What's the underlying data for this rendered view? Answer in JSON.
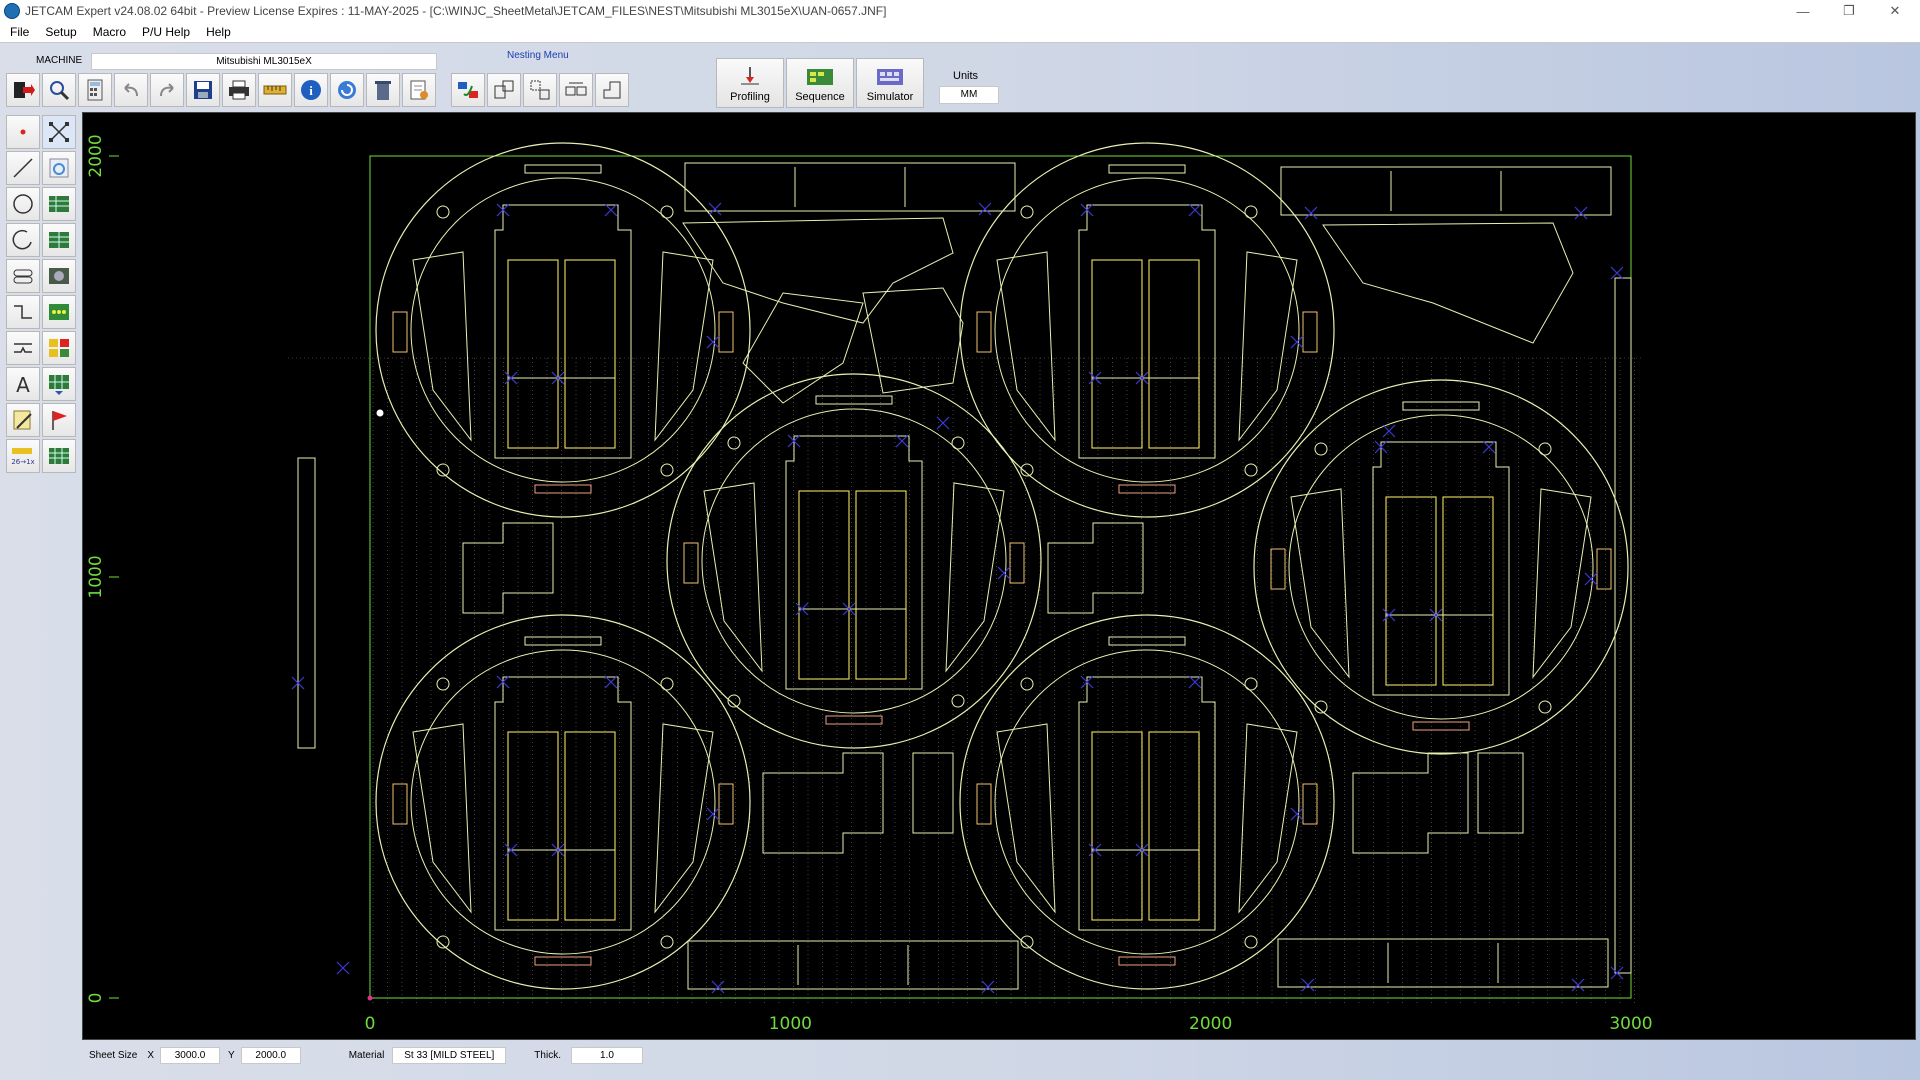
{
  "window": {
    "title": "JETCAM  Expert v24.08.02 64bit - Preview  License Expires : 11-MAY-2025  - [C:\\WINJC_SheetMetal\\JETCAM_FILES\\NEST\\Mitsubishi ML3015eX\\UAN-0657.JNF]",
    "minimize": "—",
    "restore": "❐",
    "close": "✕"
  },
  "menu": [
    "File",
    "Setup",
    "Macro",
    "P/U Help",
    "Help"
  ],
  "machine": {
    "label": "MACHINE",
    "value": "Mitsubishi ML3015eX"
  },
  "nesting_menu_label": "Nesting Menu",
  "big_buttons": [
    {
      "name": "profiling",
      "label": "Profiling",
      "icon": "profiling-icon"
    },
    {
      "name": "sequence",
      "label": "Sequence",
      "icon": "sequence-icon"
    },
    {
      "name": "simulator",
      "label": "Simulator",
      "icon": "simulator-icon"
    }
  ],
  "units": {
    "label": "Units",
    "value": "MM"
  },
  "toolbar_icons": [
    "exit-icon",
    "zoom-icon",
    "calculator-icon",
    "undo-icon",
    "redo-icon",
    "save-icon",
    "print-icon",
    "measure-icon",
    "info-icon",
    "refresh-icon",
    "delete-icon",
    "properties-icon"
  ],
  "nesting_icons": [
    "auto-nest-icon",
    "nest-part-icon",
    "move-part-icon",
    "array-part-icon",
    "remnant-icon"
  ],
  "left_tools": [
    "point-icon",
    "snap-icon",
    "line-icon",
    "part-info-icon",
    "circle-icon",
    "grid-icon",
    "arc-icon",
    "table-icon",
    "slot-icon",
    "camera-icon",
    "step-icon",
    "array-icon",
    "bridge-icon",
    "color-grid-icon",
    "text-icon",
    "part-list-icon",
    "edit-icon",
    "flag-icon",
    "dimension-icon",
    "sheet-grid-icon"
  ],
  "dimension_text": "26→1x",
  "axis": {
    "x_ticks": [
      "0",
      "1000",
      "2000",
      "3000"
    ],
    "y_ticks": [
      "0",
      "1000",
      "2000"
    ]
  },
  "colors": {
    "background": "#000000",
    "geometry": "#e8f0b0",
    "axis": "#6fdc3c",
    "markers": "#3b3bd6",
    "gridlines": "#bfbfbf"
  },
  "status": {
    "sheet_size_label": "Sheet Size",
    "x_label": "X",
    "x_value": "3000.0",
    "y_label": "Y",
    "y_value": "2000.0",
    "material_label": "Material",
    "material_value": "St 33 [MILD STEEL]",
    "thick_label": "Thick.",
    "thick_value": "1.0"
  }
}
